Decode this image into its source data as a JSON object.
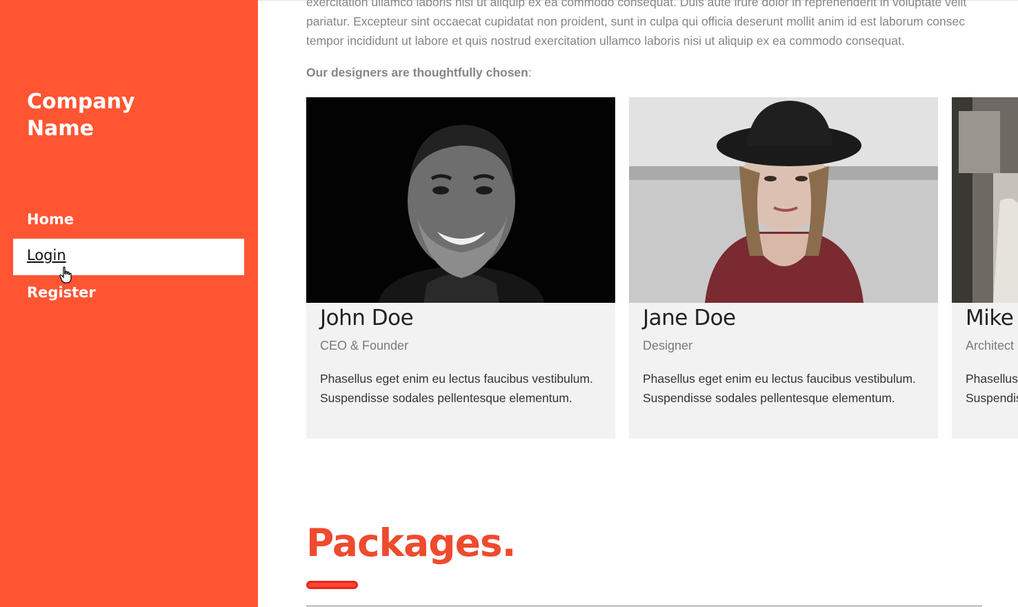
{
  "sidebar": {
    "brand_line1": "Company",
    "brand_line2": "Name",
    "nav": {
      "home": "Home",
      "login": "Login",
      "register": "Register"
    }
  },
  "about": {
    "intro_lines": [
      "exercitation ullamco laboris nisi ut aliquip ex ea commodo consequat. Duis aute irure dolor in reprehenderit in voluptate velit",
      "pariatur. Excepteur sint occaecat cupidatat non proident, sunt in culpa qui officia deserunt mollit anim id est laborum consec",
      "tempor incididunt ut labore et quis nostrud exercitation ullamco laboris nisi ut aliquip ex ea commodo consequat."
    ],
    "designers_bold": "Our designers are thoughtfully chosen",
    "designers_suffix": ":"
  },
  "team": [
    {
      "name": "John Doe",
      "role": "CEO & Founder",
      "description": "Phasellus eget enim eu lectus faucibus vestibulum. Suspendisse sodales pellentesque elementum."
    },
    {
      "name": "Jane Doe",
      "role": "Designer",
      "description": "Phasellus eget enim eu lectus faucibus vestibulum. Suspendisse sodales pellentesque elementum."
    },
    {
      "name": "Mike Ross",
      "role": "Architect",
      "description": "Phasellus eget enim eu lectus faucibus vestibulum. Suspendisse sodales pellentesque elementum."
    }
  ],
  "packages": {
    "title": "Packages."
  },
  "colors": {
    "sidebar": "#ff5533",
    "accent": "#ef4a2e",
    "card_bg": "#f2f2f2"
  }
}
